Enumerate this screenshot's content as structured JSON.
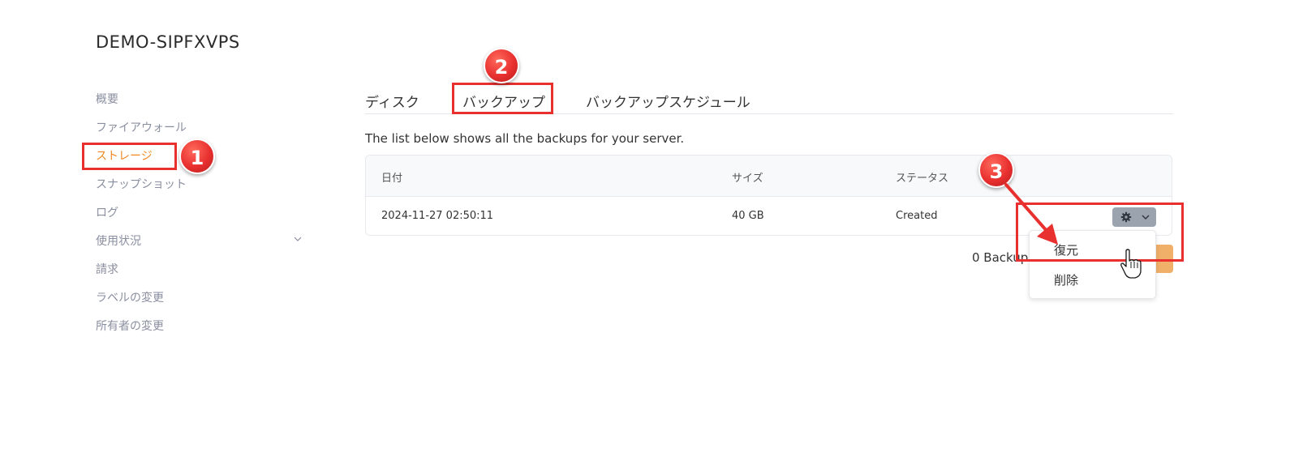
{
  "server": {
    "name": "DEMO-SIPFXVPS"
  },
  "sidebar": {
    "items": [
      {
        "label": "概要"
      },
      {
        "label": "ファイアウォール"
      },
      {
        "label": "ストレージ",
        "active": true
      },
      {
        "label": "スナップショット"
      },
      {
        "label": "ログ"
      },
      {
        "label": "使用状況",
        "has_chevron": true
      },
      {
        "label": "請求"
      },
      {
        "label": "ラベルの変更"
      },
      {
        "label": "所有者の変更"
      }
    ]
  },
  "tabs": [
    {
      "label": "ディスク"
    },
    {
      "label": "バックアップ",
      "active": true
    },
    {
      "label": "バックアップスケジュール"
    }
  ],
  "description": "The list below shows all the backups for your server.",
  "table": {
    "headers": [
      "日付",
      "サイズ",
      "ステータス"
    ],
    "rows": [
      {
        "date": "2024-11-27 02:50:11",
        "size": "40 GB",
        "status": "Created"
      }
    ]
  },
  "footer": {
    "count_text": "0 Backup"
  },
  "dropdown": {
    "items": [
      "復元",
      "削除"
    ]
  },
  "annotations": {
    "badges": [
      "1",
      "2",
      "3"
    ]
  },
  "icons": {
    "gear": "gear-icon",
    "chevron": "chevron-down-icon",
    "cursor": "hand-cursor-icon"
  },
  "colors": {
    "accent": "#f08a24",
    "highlight": "#e8302f",
    "button_gray": "#9aa3ae"
  }
}
